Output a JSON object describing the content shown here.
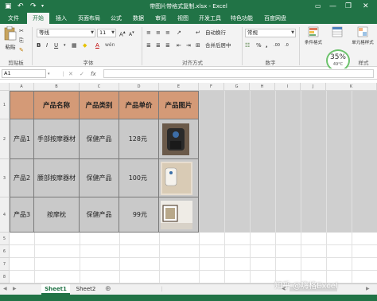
{
  "titlebar": {
    "title": "带图片带格式复制.xlsx - Excel",
    "min": "—",
    "max": "❐",
    "close": "✕"
  },
  "tabs": [
    "文件",
    "开始",
    "插入",
    "页面布局",
    "公式",
    "数据",
    "审阅",
    "视图",
    "开发工具",
    "特色功能",
    "百度网盘"
  ],
  "ribbon": {
    "paste": "粘贴",
    "clipboard": "剪贴板",
    "font_name": "等线",
    "font_size": "11",
    "font": "字体",
    "alignment": "对齐方式",
    "wrap_text": "自动换行",
    "merge_center": "合并后居中",
    "number_format": "常规",
    "number": "数字",
    "conditional": "条件格式",
    "table_format": "套用\n表格格式",
    "cell_style": "单元格样式",
    "styles": "样式"
  },
  "namebox": "A1",
  "columns": [
    "A",
    "B",
    "C",
    "D",
    "E",
    "F",
    "G",
    "H",
    "I",
    "J",
    "K"
  ],
  "rows": [
    "1",
    "2",
    "3",
    "4",
    "5",
    "6",
    "7",
    "8"
  ],
  "table": {
    "headers": [
      "产品名称",
      "产品类别",
      "产品单价",
      "产品图片"
    ],
    "rows": [
      {
        "id": "产品1",
        "name": "手部按摩器材",
        "category": "保健产品",
        "price": "128元"
      },
      {
        "id": "产品2",
        "name": "腰部按摩器材",
        "category": "保健产品",
        "price": "100元"
      },
      {
        "id": "产品3",
        "name": "按摩枕",
        "category": "保健产品",
        "price": "99元"
      }
    ]
  },
  "sheets": [
    "Sheet1",
    "Sheet2"
  ],
  "badge": {
    "percent": "35%",
    "temp": "49°C"
  },
  "watermark": "知乎 @嗨格Excel"
}
